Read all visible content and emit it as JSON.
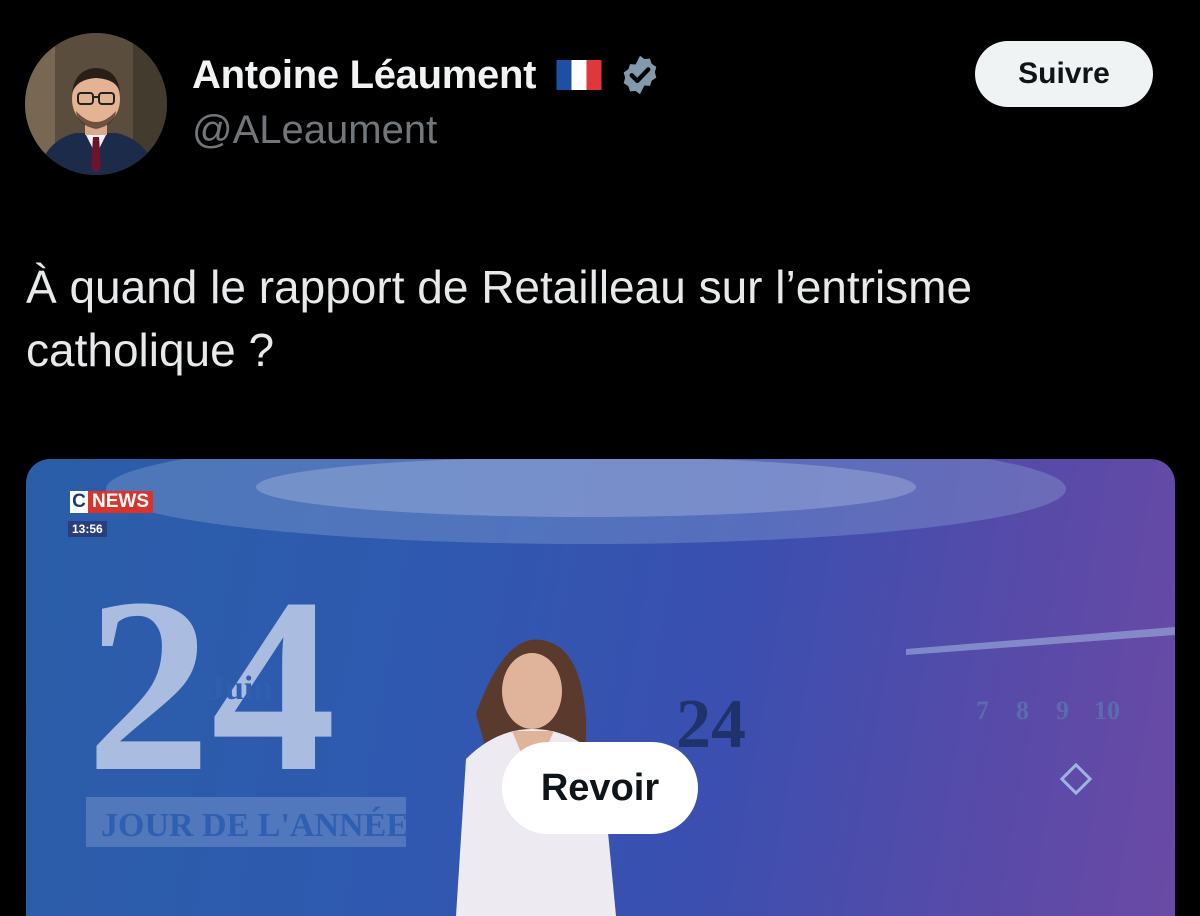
{
  "author": {
    "display_name": "Antoine Léaument",
    "flag_icon": "france-flag-icon",
    "verified_icon": "verified-badge-icon",
    "handle": "@ALeaument",
    "avatar": "profile-photo"
  },
  "follow_label": "Suivre",
  "tweet": {
    "text": "À quand le rapport de Retailleau sur l’entrisme catholique ?"
  },
  "media": {
    "channel_logo": {
      "c": "C",
      "news": "NEWS"
    },
    "time": "13:56",
    "date_day": "24",
    "date_month": "Juin",
    "banner": "JOUR DE L'ANNÉE",
    "calendar_numbers": [
      "7",
      "8",
      "9",
      "10"
    ],
    "replay_label": "Revoir"
  },
  "colors": {
    "background": "#000000",
    "follow_button": "#eff3f4",
    "verified": "#829aab",
    "handle": "#71767b"
  }
}
